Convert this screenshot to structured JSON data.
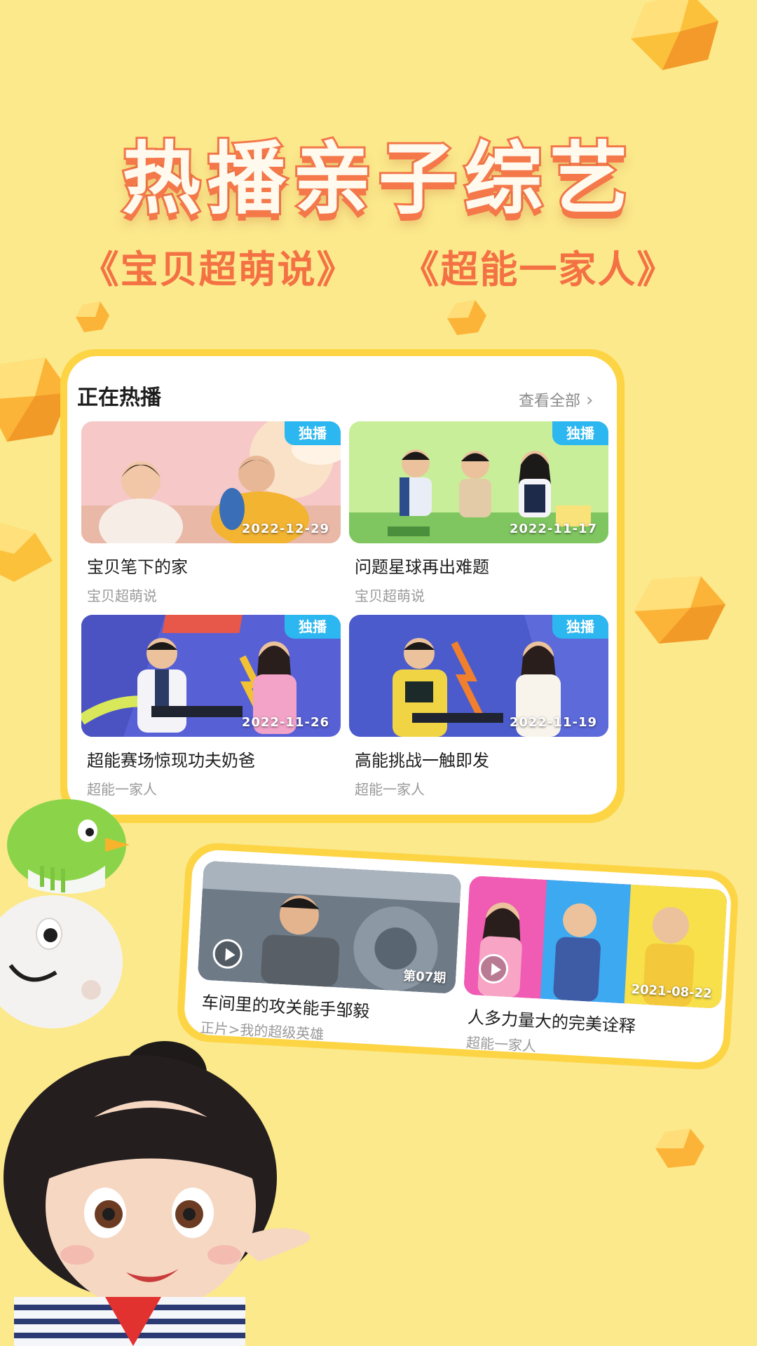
{
  "headline": "热播亲子综艺",
  "shows": [
    "《宝贝超萌说》",
    "《超能一家人》"
  ],
  "section": {
    "title": "正在热播",
    "more_label": "查看全部",
    "more_icon": "chevron-right-icon"
  },
  "videos": [
    {
      "badge": "独播",
      "date": "2022-12-29",
      "title": "宝贝笔下的家",
      "show": "宝贝超萌说"
    },
    {
      "badge": "独播",
      "date": "2022-11-17",
      "title": "问题星球再出难题",
      "show": "宝贝超萌说"
    },
    {
      "badge": "独播",
      "date": "2022-11-26",
      "title": "超能赛场惊现功夫奶爸",
      "show": "超能一家人"
    },
    {
      "badge": "独播",
      "date": "2022-11-19",
      "title": "高能挑战一触即发",
      "show": "超能一家人"
    }
  ],
  "featured": [
    {
      "episode": "第07期",
      "title": "车间里的攻关能手邹毅",
      "subtitle": "正片>我的超级英雄",
      "icon": "play-icon"
    },
    {
      "date": "2021-08-22",
      "title": "人多力量大的完美诠释",
      "subtitle": "超能一家人",
      "icon": "play-icon"
    }
  ],
  "colors": {
    "background": "#FBE98C",
    "accent_orange": "#F4784A",
    "card_border": "#FDD444",
    "badge_blue": "#2CB7F0"
  }
}
